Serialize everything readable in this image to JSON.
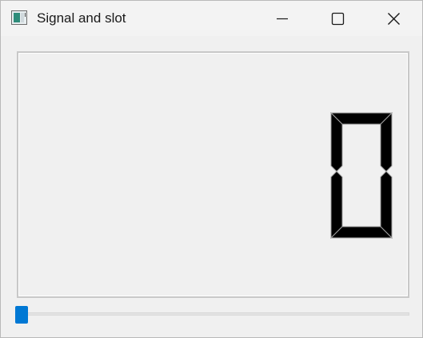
{
  "window": {
    "title": "Signal and slot",
    "icon": "qt-app-icon"
  },
  "caption_buttons": {
    "minimize": "minimize-icon",
    "maximize": "maximize-icon",
    "close": "close-icon"
  },
  "lcd": {
    "value": "0",
    "segment_color": "#000000"
  },
  "slider": {
    "value": 0,
    "min": 0,
    "accent_color": "#0078d4"
  }
}
